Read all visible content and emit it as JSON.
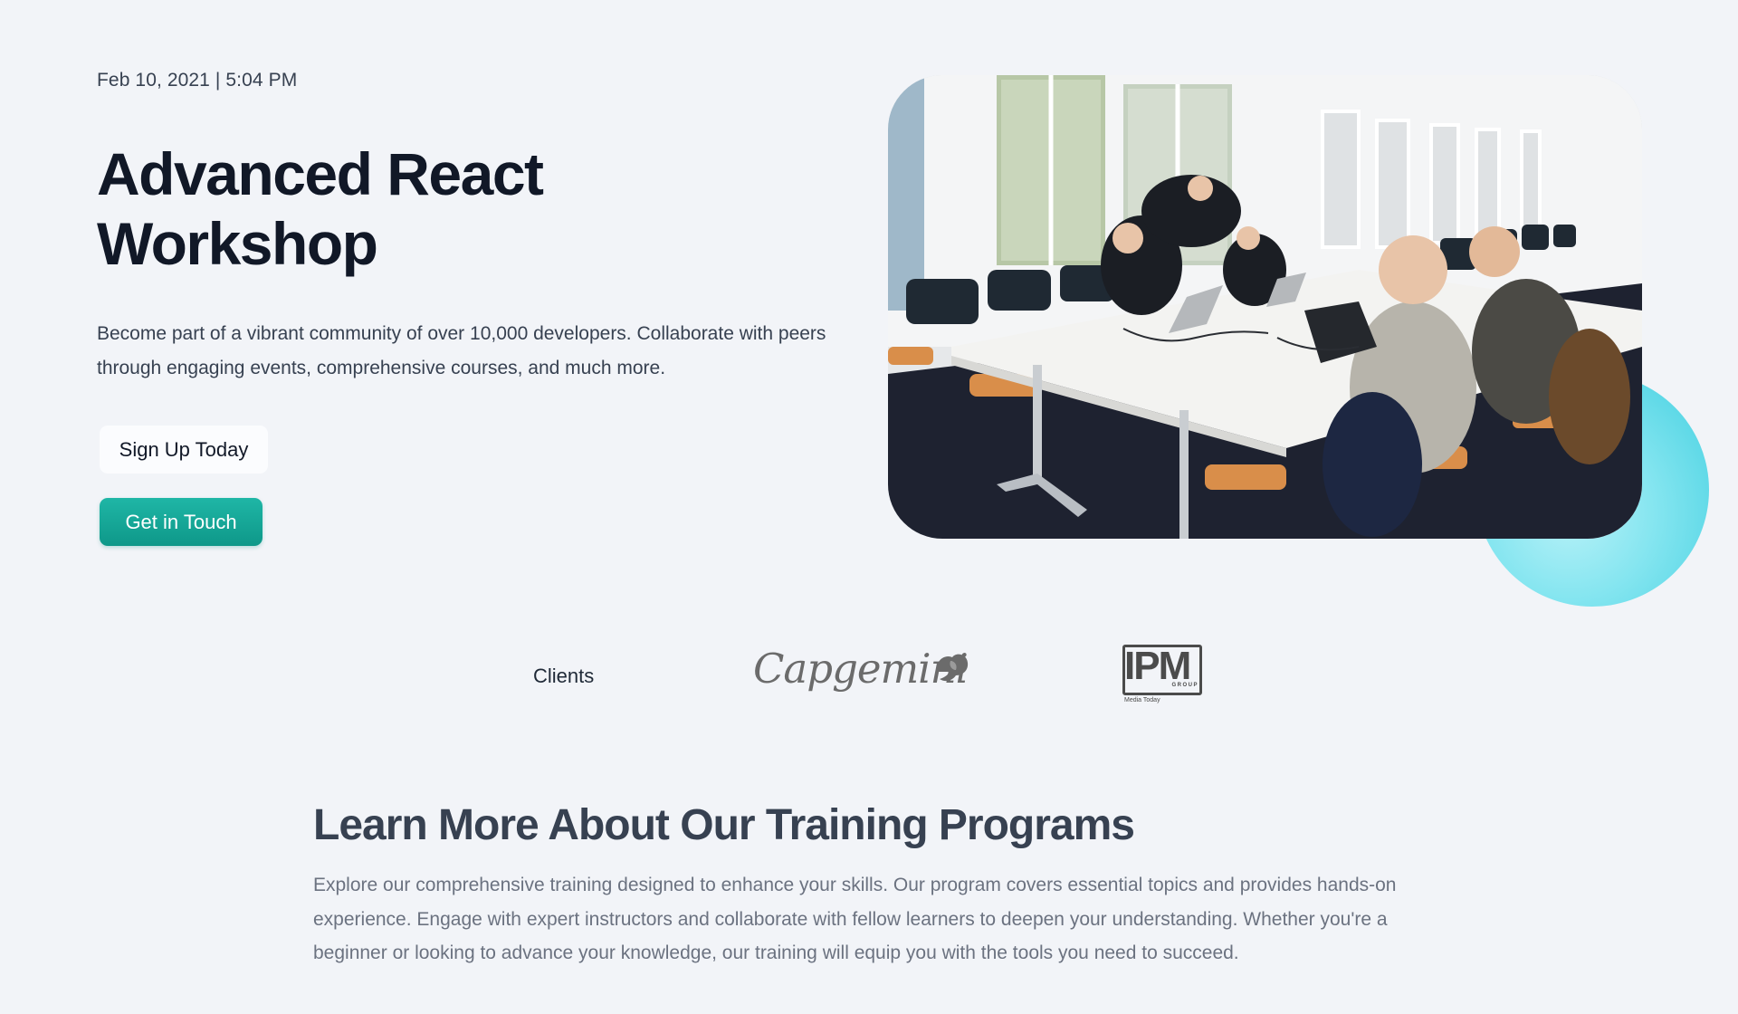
{
  "hero": {
    "meta": "Feb 10, 2021 | 5:04 PM",
    "title": "Advanced React Workshop",
    "description": "Become part of a vibrant community of over 10,000 developers. Collaborate with peers through engaging events, comprehensive courses, and much more.",
    "signup_label": "Sign Up Today",
    "contact_label": "Get in Touch",
    "image_icon": "workshop-photo",
    "accent_color": "#14a899",
    "bubble_color": "#5ad9e8"
  },
  "clients": {
    "label": "Clients",
    "logos": [
      {
        "name": "Capgemini",
        "text": "Capgemini",
        "icon": "spade-icon"
      },
      {
        "name": "IPM Group",
        "text": "IPM",
        "group": "GROUP",
        "tagline": "Media Today"
      }
    ]
  },
  "training": {
    "title": "Learn More About Our Training Programs",
    "description": "Explore our comprehensive training designed to enhance your skills. Our program covers essential topics and provides hands-on experience. Engage with expert instructors and collaborate with fellow learners to deepen your understanding. Whether you're a beginner or looking to advance your knowledge, our training will equip you with the tools you need to succeed."
  }
}
